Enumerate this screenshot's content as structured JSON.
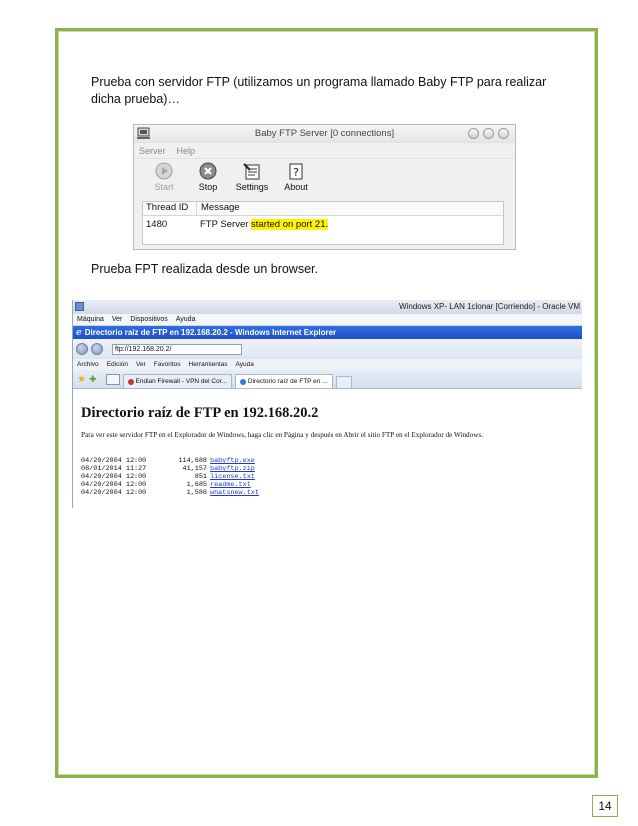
{
  "page": {
    "para1": "Prueba con servidor  FTP (utilizamos un programa llamado Baby FTP para realizar dicha prueba)…",
    "para2": "Prueba FPT realizada desde un browser.",
    "page_number": "14"
  },
  "babyftp": {
    "title": "Baby FTP Server [0 connections]",
    "menu": [
      "Server",
      "Help"
    ],
    "toolbar": {
      "start": "Start",
      "stop": "Stop",
      "settings": "Settings",
      "about": "About"
    },
    "columns": [
      "Thread ID",
      "Message"
    ],
    "rows": [
      {
        "thread": "1480",
        "message_plain": "FTP Server ",
        "message_highlight": "started on port 21."
      }
    ]
  },
  "virtualbox": {
    "title": "Windows XP- LAN 1clonar [Corriendo] - Oracle VM",
    "menu": [
      "Máquina",
      "Ver",
      "Dispositivos",
      "Ayuda"
    ]
  },
  "ie": {
    "title": "Directorio raíz de FTP en 192.168.20.2 - Windows Internet Explorer",
    "address": "ftp://192.168.20.2/",
    "menu": [
      "Archivo",
      "Edición",
      "Ver",
      "Favoritos",
      "Herramientas",
      "Ayuda"
    ],
    "tabs": [
      "Endian Firewall - VPN del Cor...",
      "Directorio raíz de FTP en ..."
    ],
    "heading": "Directorio raíz de FTP en 192.168.20.2",
    "instructions": "Para ver este servidor FTP en el Explorador de Windows, haga clic en Página y después en Abrir el sitio FTP en el Explorador de Windows.",
    "files": [
      {
        "date": "04/20/2004 12:00",
        "size": "114,688",
        "name": "babyftp.exe"
      },
      {
        "date": "08/01/2014 11:27",
        "size": "41,157",
        "name": "babyftp.zip"
      },
      {
        "date": "04/20/2004 12:00",
        "size": "851",
        "name": "license.txt"
      },
      {
        "date": "04/20/2004 12:00",
        "size": "1,685",
        "name": "readme.txt"
      },
      {
        "date": "04/20/2004 12:00",
        "size": "1,586",
        "name": "whatsnew.txt"
      }
    ]
  },
  "colors": {
    "border_green": "#8cb14f",
    "highlight": "#fff200",
    "ie_title_blue": "#1f4fc4",
    "link": "#1a3cc8"
  },
  "icons": [
    "ftp-app-icon",
    "start-icon",
    "stop-icon",
    "settings-icon",
    "about-icon",
    "ie-icon",
    "back-icon",
    "forward-icon",
    "favorites-star-icon",
    "add-favorite-icon"
  ]
}
